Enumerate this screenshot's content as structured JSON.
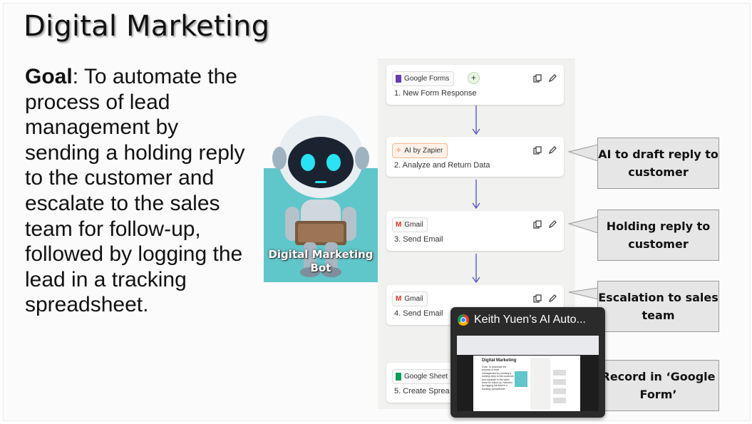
{
  "slide": {
    "title": "Digital Marketing",
    "goal_label": "Goal",
    "goal_text": ": To automate the process of lead management by sending a holding reply to the customer and escalate to the sales team for follow-up, followed by logging the lead in a tracking spreadsheet."
  },
  "robot": {
    "caption": "Digital Marketing Bot"
  },
  "flow": {
    "steps": [
      {
        "app": "Google Forms",
        "label": "1. New Form Response",
        "icon": "google-forms-icon"
      },
      {
        "app": "AI by Zapier",
        "label": "2. Analyze and Return Data",
        "icon": "ai-icon"
      },
      {
        "app": "Gmail",
        "label": "3. Send Email",
        "icon": "gmail-icon"
      },
      {
        "app": "Gmail",
        "label": "4. Send Email",
        "icon": "gmail-icon"
      },
      {
        "app": "Google Sheet",
        "label": "5. Create Sprea",
        "icon": "google-sheets-icon"
      }
    ]
  },
  "callouts": [
    "AI to draft reply to customer",
    "Holding reply to customer",
    "Escalation to sales team",
    "Record in ‘Google Form’"
  ],
  "preview": {
    "title": "Keith Yuen’s AI Auto...",
    "thumb_title": "Digital Marketing",
    "thumb_goal": "Goal: To automate the process of lead management by sending a holding reply to the customer and escalate to the sales team for follow-up, followed by logging the lead in a tracking spreadsheet."
  },
  "colors": {
    "robot_bg": "#5fc6c9",
    "callout_bg": "#e6e6e6",
    "arrow": "#5a58c8",
    "ai_chip": "#fff2ea"
  }
}
